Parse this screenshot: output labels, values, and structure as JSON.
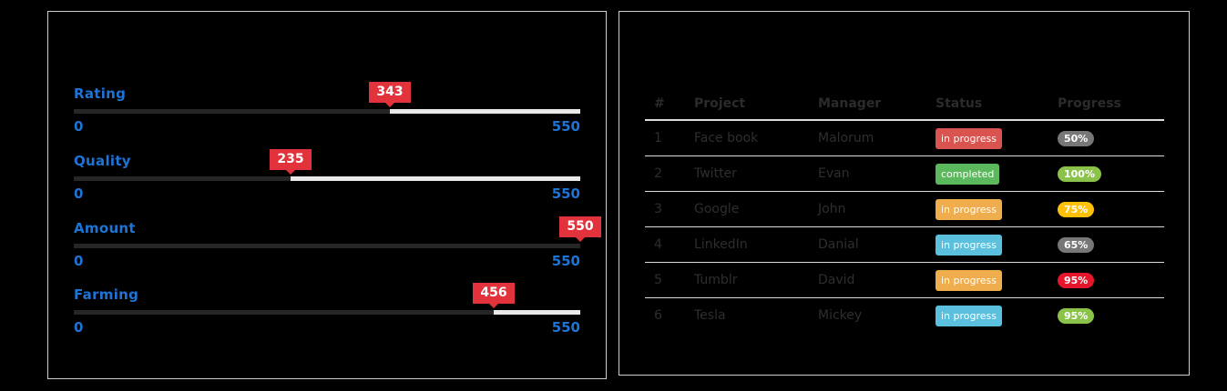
{
  "sliders": [
    {
      "label": "Rating",
      "value": 343,
      "min": "0",
      "max": "550",
      "max_value": 550
    },
    {
      "label": "Quality",
      "value": 235,
      "min": "0",
      "max": "550",
      "max_value": 550
    },
    {
      "label": "Amount",
      "value": 550,
      "min": "0",
      "max": "550",
      "max_value": 550
    },
    {
      "label": "Farming",
      "value": 456,
      "min": "0",
      "max": "550",
      "max_value": 550
    }
  ],
  "table": {
    "headers": [
      "#",
      "Project",
      "Manager",
      "Status",
      "Progress"
    ],
    "rows": [
      {
        "num": "1",
        "project": "Face book",
        "manager": "Malorum",
        "status": "in progress",
        "status_color": "#d9534f",
        "progress": "50%",
        "progress_color": "#777777"
      },
      {
        "num": "2",
        "project": "Twitter",
        "manager": "Evan",
        "status": "completed",
        "status_color": "#5cb85c",
        "progress": "100%",
        "progress_color": "#8bc34a"
      },
      {
        "num": "3",
        "project": "Google",
        "manager": "John",
        "status": "in progress",
        "status_color": "#f0ad4e",
        "progress": "75%",
        "progress_color": "#ffc107"
      },
      {
        "num": "4",
        "project": "LinkedIn",
        "manager": "Danial",
        "status": "in progress",
        "status_color": "#5bc0de",
        "progress": "65%",
        "progress_color": "#777777"
      },
      {
        "num": "5",
        "project": "Tumblr",
        "manager": "David",
        "status": "in progress",
        "status_color": "#f0ad4e",
        "progress": "95%",
        "progress_color": "#e5162c"
      },
      {
        "num": "6",
        "project": "Tesla",
        "manager": "Mickey",
        "status": "in progress",
        "status_color": "#5bc0de",
        "progress": "95%",
        "progress_color": "#8bc34a"
      }
    ]
  }
}
